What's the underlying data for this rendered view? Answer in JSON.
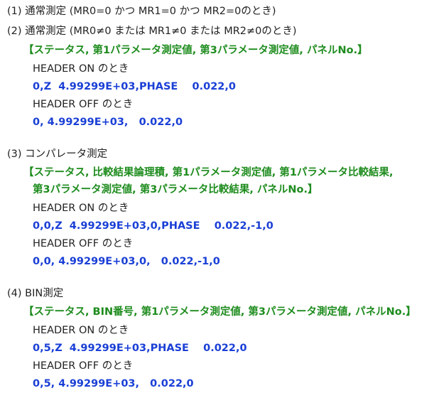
{
  "heading1": "(1) 通常測定 (MR0=0 かつ MR1=0 かつ MR2=0のとき)",
  "heading2": "(2) 通常測定 (MR0≠0 または MR1≠0 または MR2≠0のとき)",
  "s2_format": "【ステータス, 第1パラメータ測定値, 第3パラメータ測定値, パネルNo.】",
  "s2_hdr_on": "HEADER ON のとき",
  "s2_on_val": "0,Z  4.99299E+03,PHASE    0.022,0",
  "s2_hdr_off": "HEADER OFF のとき",
  "s2_off_val": "0, 4.99299E+03,   0.022,0",
  "heading3": "(3) コンパレータ測定",
  "s3_format1": "【ステータス, 比較結果論理積, 第1パラメータ測定値, 第1パラメータ比較結果,",
  "s3_format2": "第3パラメータ測定値, 第3パラメータ比較結果, パネルNo.】",
  "s3_hdr_on": "HEADER ON のとき",
  "s3_on_val": "0,0,Z  4.99299E+03,0,PHASE    0.022,-1,0",
  "s3_hdr_off": "HEADER OFF のとき",
  "s3_off_val": "0,0, 4.99299E+03,0,   0.022,-1,0",
  "heading4": "(4) BIN測定",
  "s4_format": "【ステータス, BIN番号, 第1パラメータ測定値, 第3パラメータ測定値, パネルNo.】",
  "s4_hdr_on": "HEADER ON のとき",
  "s4_on_val": "0,5,Z  4.99299E+03,PHASE    0.022,0",
  "s4_hdr_off": "HEADER OFF のとき",
  "s4_off_val": "0,5, 4.99299E+03,   0.022,0",
  "colors": {
    "text": "#222222",
    "format_green": "#1e8c1e",
    "value_blue": "#1a3fd6"
  }
}
